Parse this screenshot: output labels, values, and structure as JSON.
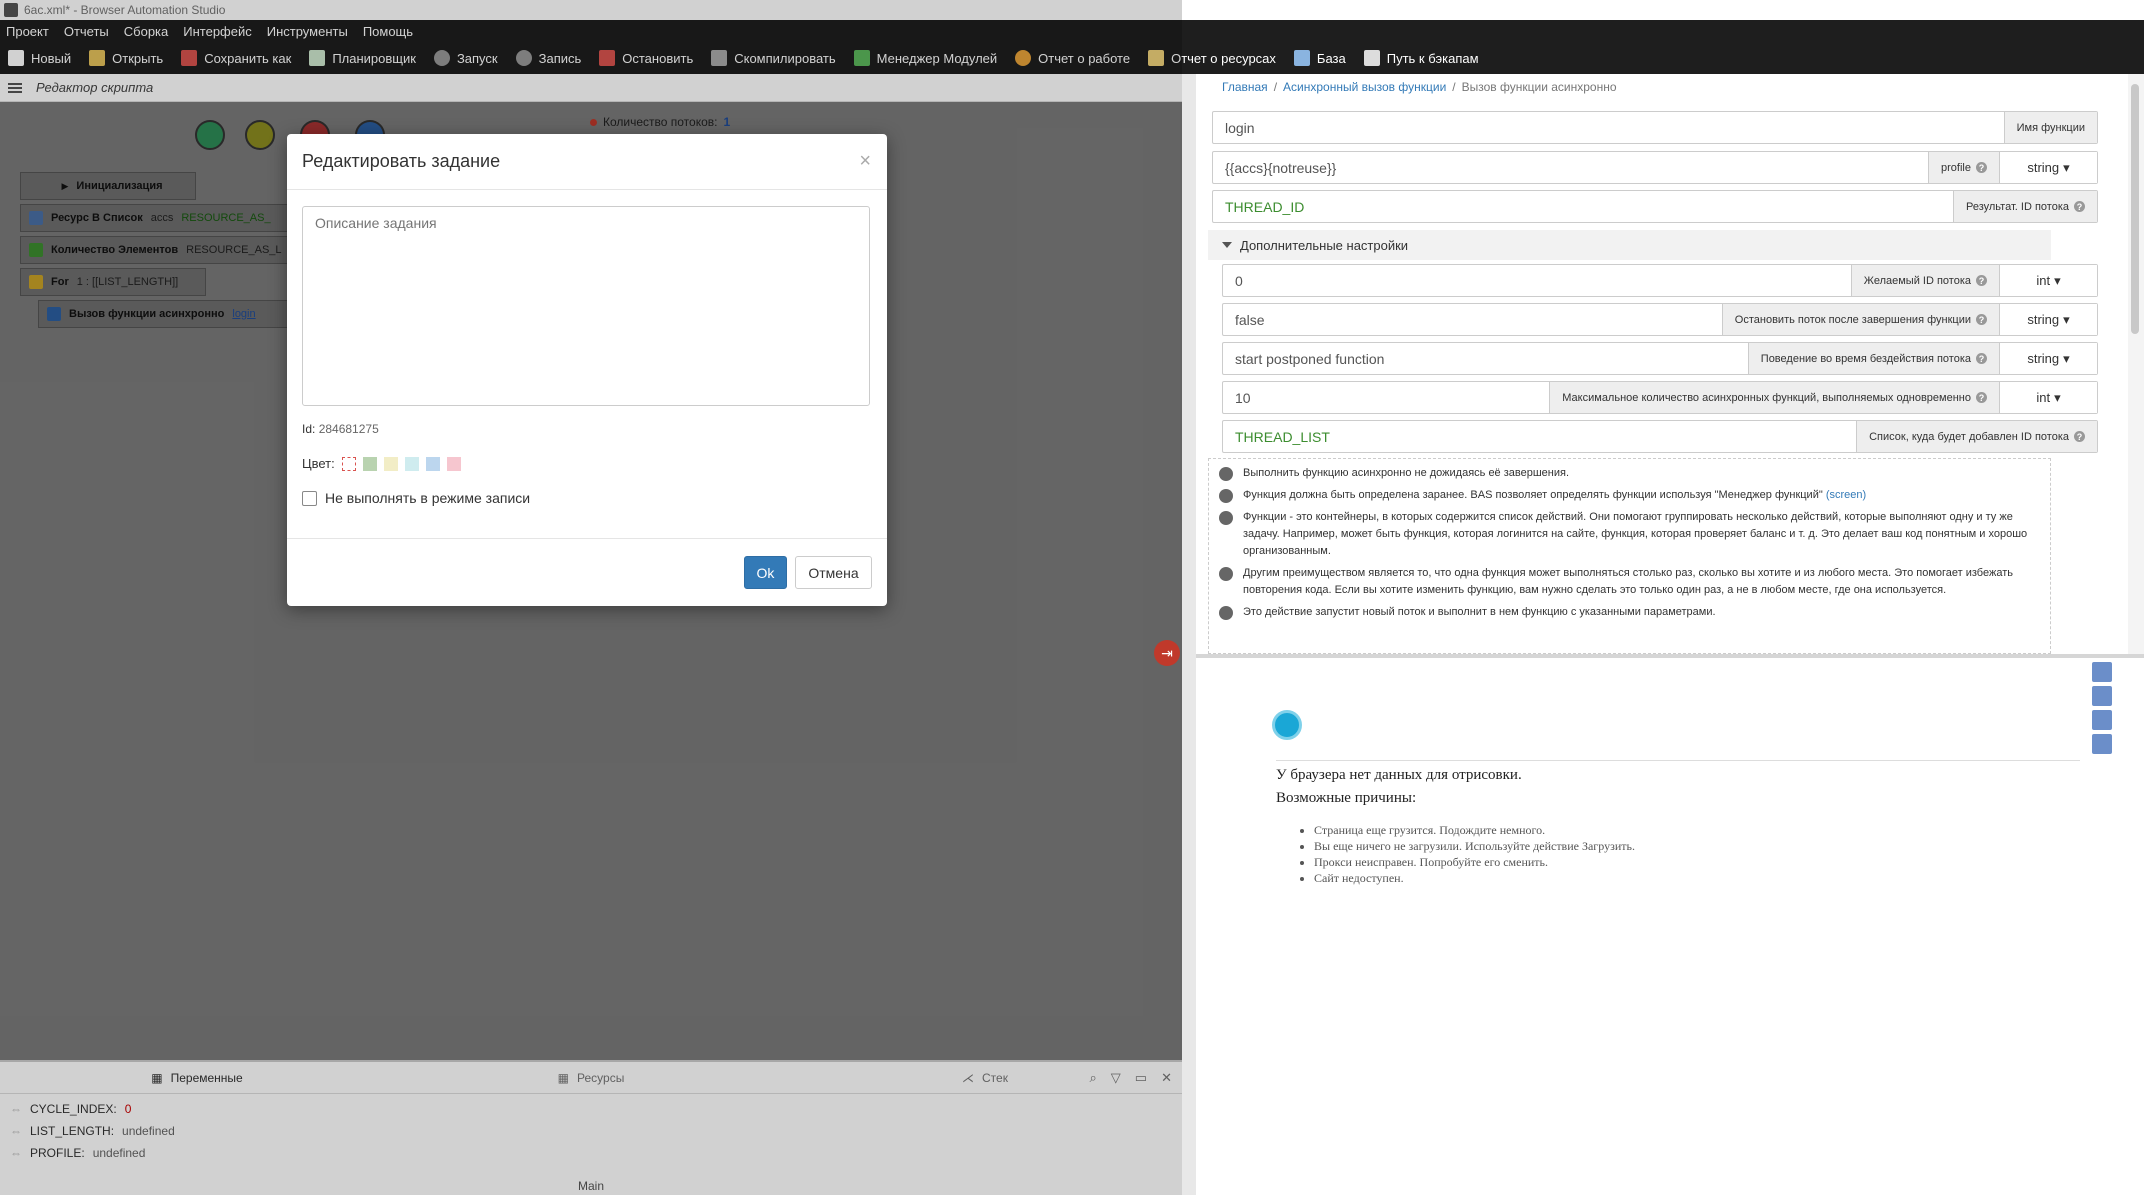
{
  "titlebar": {
    "title": "6ac.xml* - Browser Automation Studio"
  },
  "menu": [
    "Проект",
    "Отчеты",
    "Сборка",
    "Интерфейс",
    "Инструменты",
    "Помощь"
  ],
  "toolbar": [
    {
      "label": "Новый",
      "icon": "new-file-icon",
      "color": "#ffffff"
    },
    {
      "label": "Открыть",
      "icon": "folder-icon",
      "color": "#e6c35c"
    },
    {
      "label": "Сохранить как",
      "icon": "save-icon",
      "color": "#d9534f"
    },
    {
      "label": "Планировщик",
      "icon": "calendar-icon",
      "color": "#cfe8cf"
    },
    {
      "label": "Запуск",
      "icon": "play-icon",
      "color": "#999999"
    },
    {
      "label": "Запись",
      "icon": "record-icon",
      "color": "#999999"
    },
    {
      "label": "Остановить",
      "icon": "stop-icon",
      "color": "#d9534f"
    },
    {
      "label": "Скомпилировать",
      "icon": "box-icon",
      "color": "#aaaaaa"
    },
    {
      "label": "Менеджер Модулей",
      "icon": "puzzle-icon",
      "color": "#5cb85c"
    },
    {
      "label": "Отчет о работе",
      "icon": "pie-chart-icon",
      "color": "#e8a33a"
    },
    {
      "label": "Отчет о ресурсах",
      "icon": "note-icon",
      "color": "#f0d27a"
    },
    {
      "label": "База",
      "icon": "database-icon",
      "color": "#8ab4e0"
    },
    {
      "label": "Путь к бэкапам",
      "icon": "backup-icon",
      "color": "#dddddd"
    }
  ],
  "editor": {
    "title": "Редактор скрипта",
    "threads_label": "Количество потоков:",
    "threads_value": "1",
    "nodes": {
      "init": "Инициализация",
      "n1_label": "Ресурс В Список",
      "n1_arg": "accs",
      "n1_res": "RESOURCE_AS_",
      "n2_label": "Количество Элементов",
      "n2_arg": "RESOURCE_AS_L",
      "n3_label": "For",
      "n3_arg": "1 : [[LIST_LENGTH]]",
      "n4_label": "Вызов функции асинхронно",
      "n4_arg": "login"
    }
  },
  "bottom": {
    "tabs": [
      "Переменные",
      "Ресурсы",
      "Стек"
    ],
    "vars": [
      {
        "name": "CYCLE_INDEX:",
        "value": "0"
      },
      {
        "name": "LIST_LENGTH:",
        "value": "undefined"
      },
      {
        "name": "PROFILE:",
        "value": "undefined"
      }
    ],
    "main": "Main"
  },
  "modal": {
    "title": "Редактировать задание",
    "close": "×",
    "description_placeholder": "Описание задания",
    "id_label": "Id:",
    "id_value": "284681275",
    "color_label": "Цвет:",
    "colors": [
      "#ffffff",
      "#b9d3b0",
      "#f2edc6",
      "#cfecef",
      "#bcd6ee",
      "#f6c6cf"
    ],
    "checkbox_label": "Не выполнять в режиме записи",
    "ok": "Ok",
    "cancel": "Отмена"
  },
  "right": {
    "breadcrumb": [
      "Главная",
      "Асинхронный вызов функции",
      "Вызов функции асинхронно"
    ],
    "fields": {
      "func_value": "login",
      "func_label": "Имя функции",
      "profile_value": "{{accs}{notreuse}}",
      "profile_label": "profile",
      "profile_type": "string",
      "result_value": "THREAD_ID",
      "result_label": "Результат. ID потока"
    },
    "advanced": {
      "title": "Дополнительные настройки",
      "thread_id_value": "0",
      "thread_id_label": "Желаемый ID потока",
      "thread_id_type": "int",
      "stop_value": "false",
      "stop_label": "Остановить поток после завершения функции",
      "stop_type": "string",
      "idle_value": "start postponed function",
      "idle_label": "Поведение во время бездействия потока",
      "idle_type": "string",
      "max_value": "10",
      "max_label": "Максимальное количество асинхронных функций, выполняемых одновременно",
      "max_type": "int",
      "list_value": "THREAD_LIST",
      "list_label": "Список, куда будет добавлен ID потока"
    },
    "info": [
      "Выполнить функцию асинхронно не дожидаясь её завершения.",
      "Функция должна быть определена заранее. BAS позволяет определять функции используя \"Менеджер функций\"",
      "(screen)",
      "Функции - это контейнеры, в которых содержится список действий. Они помогают группировать несколько действий, которые выполняют одну и ту же задачу. Например, может быть функция, которая логинится на сайте, функция, которая проверяет баланс и т. д. Это делает ваш код понятным и хорошо организованным.",
      "Другим преимуществом является то, что одна функция может выполняться столько раз, сколько вы хотите и из любого места. Это помогает избежать повторения кода. Если вы хотите изменить функцию, вам нужно сделать это только один раз, а не в любом месте, где она используется.",
      "Это действие запустит новый поток и выполнит в нем функцию с указанными параметрами."
    ]
  },
  "browser": {
    "heading": "У браузера нет данных для отрисовки.",
    "reasons_title": "Возможные причины:",
    "reasons": [
      "Страница еще грузится. Подождите немного.",
      "Вы еще ничего не загрузили. Используйте действие Загрузить.",
      "Прокси неисправен. Попробуйте его сменить.",
      "Сайт недоступен."
    ]
  }
}
